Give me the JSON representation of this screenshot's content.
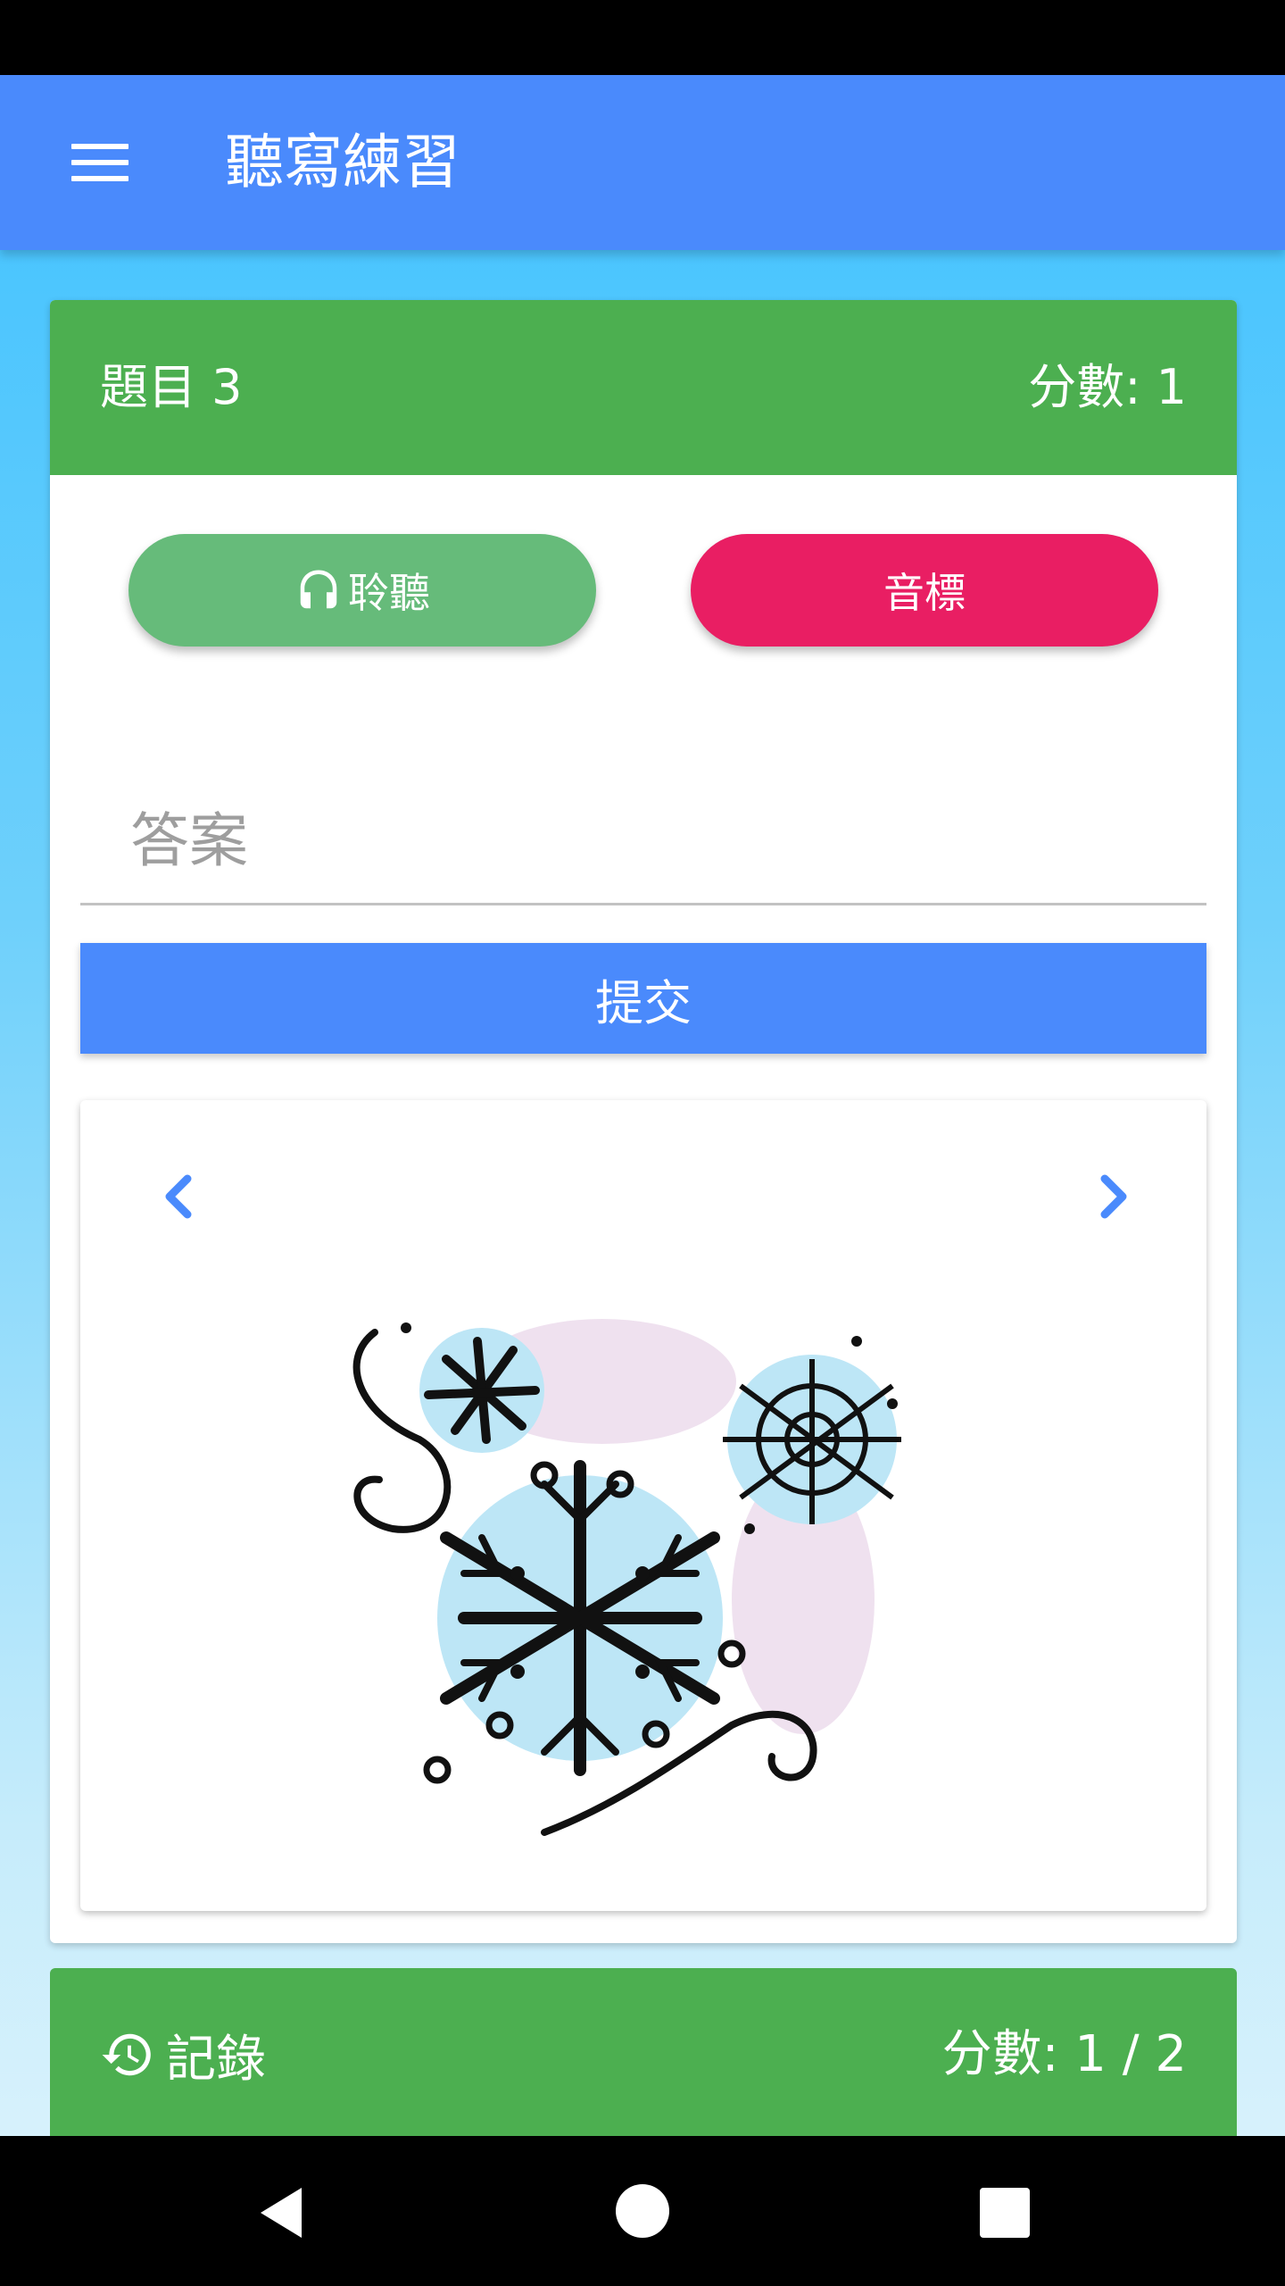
{
  "app": {
    "title": "聽寫練習"
  },
  "question": {
    "label": "題目 3",
    "score_label": "分數: 1",
    "listen_label": "聆聽",
    "phonetic_label": "音標",
    "answer_placeholder": "答案",
    "answer_value": "",
    "submit_label": "提交"
  },
  "image": {
    "subject": "snowflakes"
  },
  "history": {
    "label": "記錄",
    "score_label": "分數: 1 / 2"
  },
  "colors": {
    "app_bar": "#4a8afc",
    "header_green": "#4caf50",
    "listen_button": "#66bb7a",
    "phonetic_button": "#e91e63",
    "submit_button": "#4a8afc",
    "nav_arrows": "#4a8afc"
  }
}
